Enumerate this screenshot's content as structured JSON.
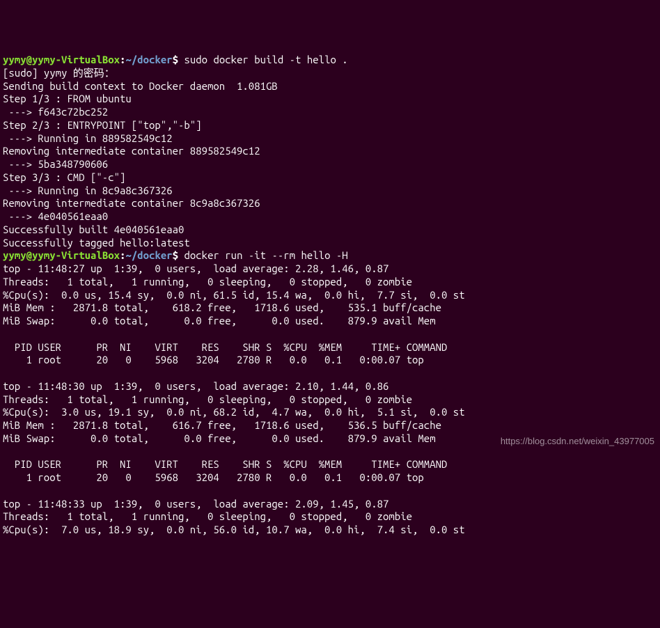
{
  "prompt1": {
    "user": "yymy",
    "at": "@",
    "host": "yymy-VirtualBox",
    "colon": ":",
    "tilde": "~",
    "slash": "/",
    "path": "docker",
    "dollar": "$",
    "command": "sudo docker build -t hello ."
  },
  "build_output": [
    "[sudo] yymy 的密码：",
    "Sending build context to Docker daemon  1.081GB",
    "Step 1/3 : FROM ubuntu",
    " ---> f643c72bc252",
    "Step 2/3 : ENTRYPOINT [\"top\",\"-b\"]",
    " ---> Running in 889582549c12",
    "Removing intermediate container 889582549c12",
    " ---> 5ba348790606",
    "Step 3/3 : CMD [\"-c\"]",
    " ---> Running in 8c9a8c367326",
    "Removing intermediate container 8c9a8c367326",
    " ---> 4e040561eaa0",
    "Successfully built 4e040561eaa0",
    "Successfully tagged hello:latest"
  ],
  "prompt2": {
    "user": "yymy",
    "at": "@",
    "host": "yymy-VirtualBox",
    "colon": ":",
    "tilde": "~",
    "slash": "/",
    "path": "docker",
    "dollar": "$",
    "command": "docker run -it --rm hello -H"
  },
  "top_output": [
    "top - 11:48:27 up  1:39,  0 users,  load average: 2.28, 1.46, 0.87",
    "Threads:   1 total,   1 running,   0 sleeping,   0 stopped,   0 zombie",
    "%Cpu(s):  0.0 us, 15.4 sy,  0.0 ni, 61.5 id, 15.4 wa,  0.0 hi,  7.7 si,  0.0 st",
    "MiB Mem :   2871.8 total,    618.2 free,   1718.6 used,    535.1 buff/cache",
    "MiB Swap:      0.0 total,      0.0 free,      0.0 used.    879.9 avail Mem",
    "",
    "  PID USER      PR  NI    VIRT    RES    SHR S  %CPU  %MEM     TIME+ COMMAND",
    "    1 root      20   0    5968   3204   2780 R   0.0   0.1   0:00.07 top",
    "",
    "top - 11:48:30 up  1:39,  0 users,  load average: 2.10, 1.44, 0.86",
    "Threads:   1 total,   1 running,   0 sleeping,   0 stopped,   0 zombie",
    "%Cpu(s):  3.0 us, 19.1 sy,  0.0 ni, 68.2 id,  4.7 wa,  0.0 hi,  5.1 si,  0.0 st",
    "MiB Mem :   2871.8 total,    616.7 free,   1718.6 used,    536.5 buff/cache",
    "MiB Swap:      0.0 total,      0.0 free,      0.0 used.    879.9 avail Mem",
    "",
    "  PID USER      PR  NI    VIRT    RES    SHR S  %CPU  %MEM     TIME+ COMMAND",
    "    1 root      20   0    5968   3204   2780 R   0.0   0.1   0:00.07 top",
    "",
    "top - 11:48:33 up  1:39,  0 users,  load average: 2.09, 1.45, 0.87",
    "Threads:   1 total,   1 running,   0 sleeping,   0 stopped,   0 zombie",
    "%Cpu(s):  7.0 us, 18.9 sy,  0.0 ni, 56.0 id, 10.7 wa,  0.0 hi,  7.4 si,  0.0 st"
  ],
  "watermark": "https://blog.csdn.net/weixin_43977005"
}
